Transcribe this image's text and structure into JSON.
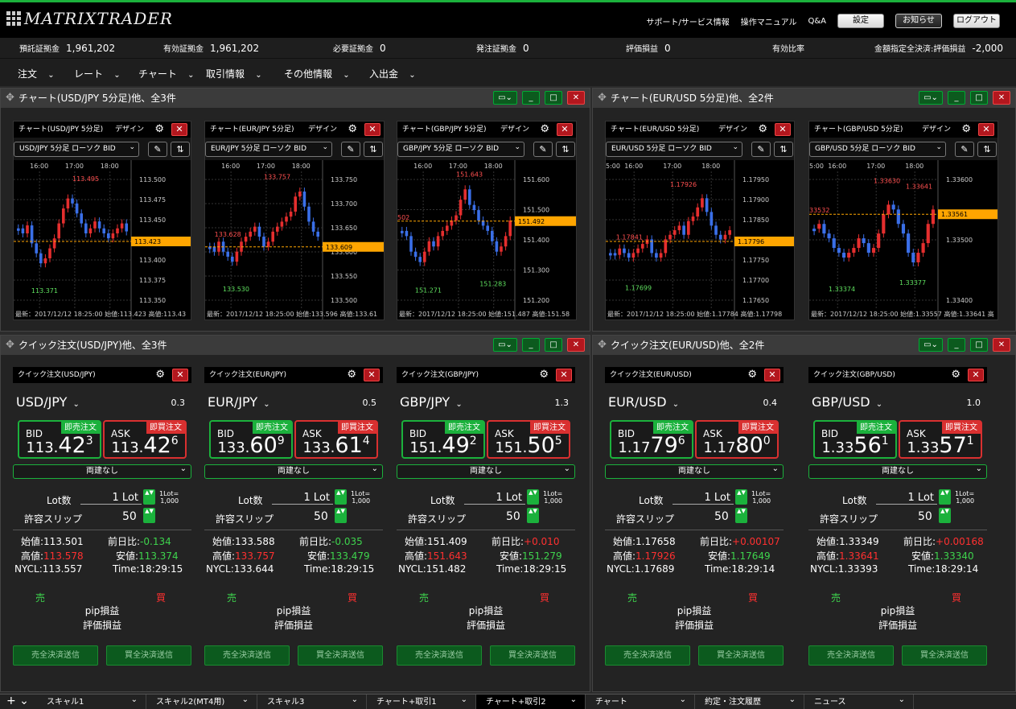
{
  "header": {
    "logo": "MATRIXTRADER",
    "links": [
      "サポート/サービス情報",
      "操作マニュアル",
      "Q&A"
    ],
    "buttons": [
      "設定",
      "お知らせ",
      "ログアウト"
    ]
  },
  "account": [
    {
      "label": "預託証拠金",
      "value": "1,961,202"
    },
    {
      "label": "有効証拠金",
      "value": "1,961,202"
    },
    {
      "label": "必要証拠金",
      "value": "0"
    },
    {
      "label": "発注証拠金",
      "value": "0"
    },
    {
      "label": "評価損益",
      "value": "0"
    },
    {
      "label": "有効比率",
      "value": ""
    },
    {
      "label": "金額指定全決済:評価損益",
      "value": "-2,000"
    }
  ],
  "menu": [
    "注文",
    "レート",
    "チャート",
    "取引情報",
    "その他情報",
    "入出金"
  ],
  "panels": {
    "chart_left": "チャート(USD/JPY 5分足)他、全3件",
    "chart_right": "チャート(EUR/USD 5分足)他、全2件",
    "quick_left": "クイック注文(USD/JPY)他、全3件",
    "quick_right": "クイック注文(EUR/USD)他、全2件"
  },
  "chart_common": {
    "design": "デザイン",
    "times": [
      "16:00",
      "17:00",
      "18:00"
    ]
  },
  "charts": [
    {
      "title": "チャート(USD/JPY 5分足)",
      "select": "USD/JPY 5分足 ローソク BID",
      "axis": [
        "113.500",
        "113.475",
        "113.450",
        "113.425",
        "113.400",
        "113.375",
        "113.350"
      ],
      "current": "113.423",
      "high_label": "113.495",
      "low_label": "113.371",
      "footer": "最新：2017/12/12 18:25:00 始値:113.423 高値:113.43",
      "chart_data": {
        "type": "candlestick",
        "series": "BID",
        "ylim": [
          113.34,
          113.51
        ],
        "high": 113.495,
        "low": 113.371,
        "last": 113.423
      }
    },
    {
      "title": "チャート(EUR/JPY 5分足)",
      "select": "EUR/JPY 5分足 ローソク BID",
      "axis": [
        "133.750",
        "133.700",
        "133.650",
        "133.600",
        "133.550",
        "133.500"
      ],
      "current": "133.609",
      "high_label": "133.757",
      "low_label": "133.530",
      "extra_label": "133.628",
      "footer": "最新：2017/12/12 18:25:00 始値:133.596 高値:133.61",
      "chart_data": {
        "type": "candlestick",
        "series": "BID",
        "ylim": [
          133.47,
          133.78
        ],
        "high": 133.757,
        "low": 133.53,
        "last": 133.609
      }
    },
    {
      "title": "チャート(GBP/JPY 5分足)",
      "select": "GBP/JPY 5分足 ローソク BID",
      "axis": [
        "151.600",
        "151.500",
        "151.400",
        "151.300",
        "151.200"
      ],
      "current": "151.492",
      "high_label": "151.643",
      "low_label": "151.271",
      "low2_label": "151.283",
      "left_label": "502",
      "footer": "最新：2017/12/12 18:25:00 始値:151.487 高値:151.58",
      "chart_data": {
        "type": "candlestick",
        "series": "BID",
        "ylim": [
          151.18,
          151.67
        ],
        "high": 151.643,
        "low": 151.271,
        "last": 151.492
      }
    },
    {
      "title": "チャート(EUR/USD 5分足)",
      "select": "EUR/USD 5分足 ローソク BID",
      "axis": [
        "1.17950",
        "1.17900",
        "1.17850",
        "1.17800",
        "1.17750",
        "1.17700",
        "1.17650"
      ],
      "current": "1.17796",
      "high_label": "1.17926",
      "low_label": "1.17699",
      "extra_label": "1.17841",
      "edge": "5:00",
      "footer": "最新：2017/12/12 18:25:00 始値:1.17784 高値:1.17798",
      "chart_data": {
        "type": "candlestick",
        "series": "BID",
        "ylim": [
          1.1763,
          1.1797
        ],
        "high": 1.17926,
        "low": 1.17699,
        "last": 1.17796
      }
    },
    {
      "title": "チャート(GBP/USD 5分足)",
      "select": "GBP/USD 5分足 ローソク BID",
      "axis": [
        "1.33600",
        "1.33500",
        "1.33400"
      ],
      "current": "1.33561",
      "high_label": "1.33630",
      "high2_label": "1.33641",
      "low_label": "1.33374",
      "low2_label": "1.33377",
      "left_label": "33532",
      "edge": "5:00",
      "footer": "最新：2017/12/12 18:25:00 始値:1.33557 高値:1.33641 高",
      "chart_data": {
        "type": "candlestick",
        "series": "BID",
        "ylim": [
          1.333,
          1.3368
        ],
        "high": 1.33641,
        "low": 1.33374,
        "last": 1.33561
      }
    }
  ],
  "quick_common": {
    "bid": "BID",
    "ask": "ASK",
    "sell_tag": "即売注文",
    "buy_tag": "即買注文",
    "no_ryodate": "両建なし",
    "lot_label": "Lot数",
    "lot_value": "1 Lot",
    "lot_note1": "1Lot=",
    "lot_note2": "1,000",
    "slip_label": "許容スリップ",
    "slip_value": "50",
    "open_label": "始値:",
    "high_label": "高値:",
    "nycl_label": "NYCL:",
    "prev_label": "前日比:",
    "low_label": "安値:",
    "time_label": "Time:",
    "sell": "売",
    "buy": "買",
    "pip": "pip損益",
    "eval": "評価損益",
    "close_sell": "売全決済送信",
    "close_buy": "買全決済送信"
  },
  "quicks": [
    {
      "title": "クイック注文(USD/JPY)",
      "pair": "USD/JPY",
      "spread": "0.3",
      "bid": [
        "113.",
        "42",
        "3"
      ],
      "ask": [
        "113.",
        "42",
        "6"
      ],
      "open": "113.501",
      "prev": "-0.134",
      "prev_dir": "dn",
      "high": "113.578",
      "low": "113.374",
      "nycl": "113.557",
      "time": "18:29:15"
    },
    {
      "title": "クイック注文(EUR/JPY)",
      "pair": "EUR/JPY",
      "spread": "0.5",
      "bid": [
        "133.",
        "60",
        "9"
      ],
      "ask": [
        "133.",
        "61",
        "4"
      ],
      "open": "133.588",
      "prev": "-0.035",
      "prev_dir": "dn",
      "high": "133.757",
      "low": "133.479",
      "nycl": "133.644",
      "time": "18:29:15"
    },
    {
      "title": "クイック注文(GBP/JPY)",
      "pair": "GBP/JPY",
      "spread": "1.3",
      "bid": [
        "151.",
        "49",
        "2"
      ],
      "ask": [
        "151.",
        "50",
        "5"
      ],
      "open": "151.409",
      "prev": "+0.010",
      "prev_dir": "up",
      "high": "151.643",
      "low": "151.279",
      "nycl": "151.482",
      "time": "18:29:15"
    },
    {
      "title": "クイック注文(EUR/USD)",
      "pair": "EUR/USD",
      "spread": "0.4",
      "bid": [
        "1.17",
        "79",
        "6"
      ],
      "ask": [
        "1.17",
        "80",
        "0"
      ],
      "open": "1.17658",
      "prev": "+0.00107",
      "prev_dir": "up",
      "high": "1.17926",
      "low": "1.17649",
      "nycl": "1.17689",
      "time": "18:29:14"
    },
    {
      "title": "クイック注文(GBP/USD)",
      "pair": "GBP/USD",
      "spread": "1.0",
      "bid": [
        "1.33",
        "56",
        "1"
      ],
      "ask": [
        "1.33",
        "57",
        "1"
      ],
      "open": "1.33349",
      "prev": "+0.00168",
      "prev_dir": "up",
      "high": "1.33641",
      "low": "1.33340",
      "nycl": "1.33393",
      "time": "18:29:14"
    }
  ],
  "tabs": [
    "スキャル1",
    "スキャル2(MT4用)",
    "スキャル3",
    "チャート+取引1",
    "チャート+取引2",
    "チャート",
    "約定・注文履歴",
    "ニュース"
  ],
  "colors": {
    "accent": "#1bb13c",
    "sell": "#3ed34d",
    "buy": "#ff3030",
    "candle_up": "#e52e2e",
    "candle_down": "#3a6fe8",
    "current_line": "#ffa500"
  }
}
